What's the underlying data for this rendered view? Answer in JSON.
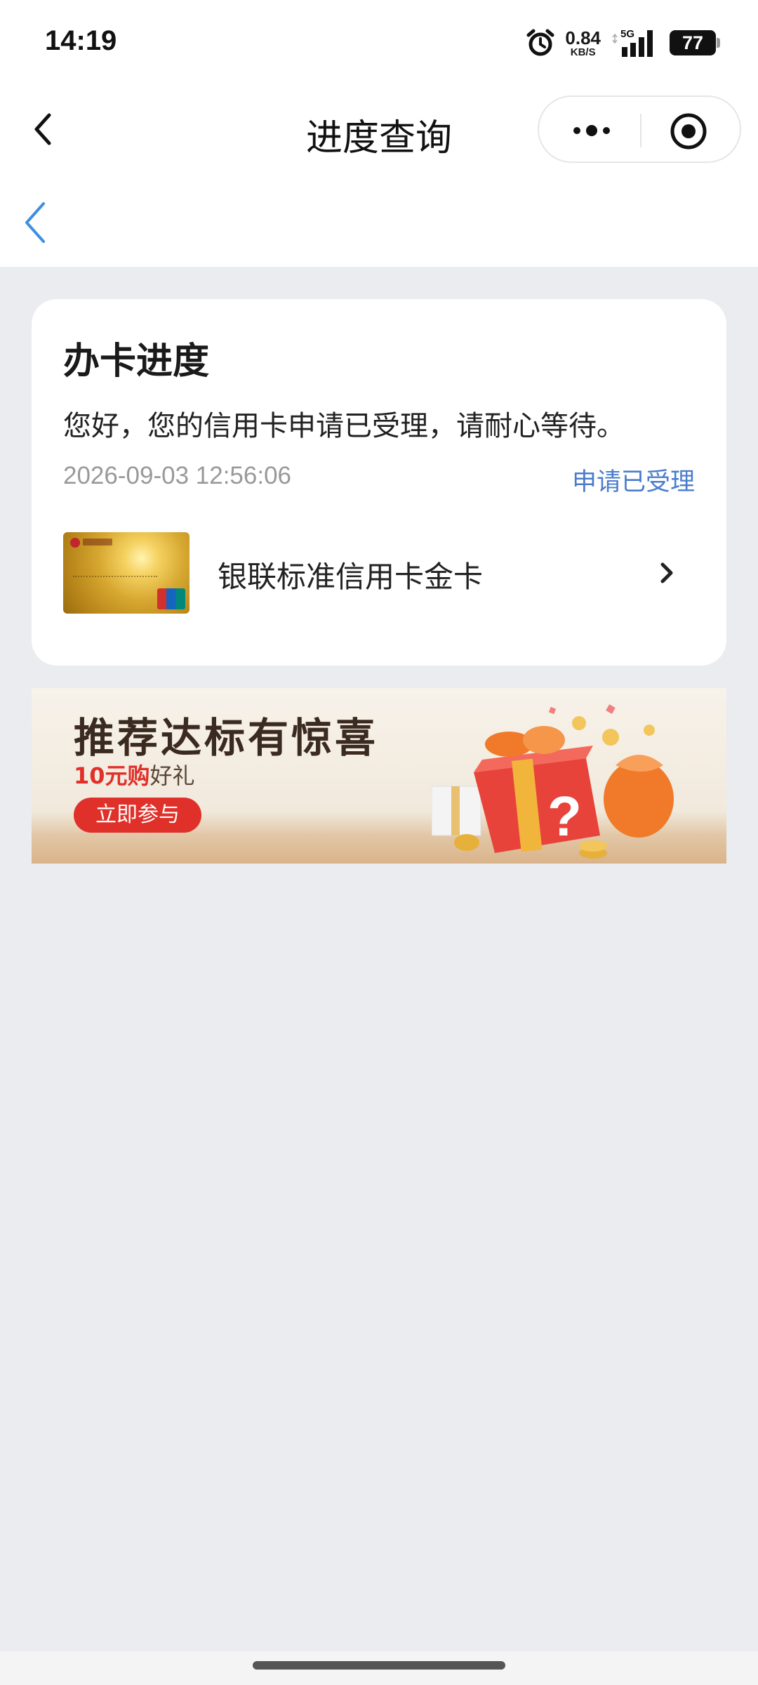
{
  "status_bar": {
    "time": "14:19",
    "net_speed_value": "0.84",
    "net_speed_unit": "KB/S",
    "network": "5G",
    "battery": "77"
  },
  "nav": {
    "title": "进度查询"
  },
  "progress_card": {
    "title": "办卡进度",
    "message": "您好，您的信用卡申请已受理，请耐心等待。",
    "datetime": "2026-09-03 12:56:06",
    "status": "申请已受理",
    "card_name": "银联标准信用卡金卡"
  },
  "promo_banner": {
    "title": "推荐达标有惊喜",
    "subtitle_highlight": "10元购",
    "subtitle_rest": "好礼",
    "button_label": "立即参与"
  },
  "colors": {
    "accent_blue": "#4a7ccc",
    "promo_red": "#e0302a",
    "page_background": "#eaecf0"
  }
}
